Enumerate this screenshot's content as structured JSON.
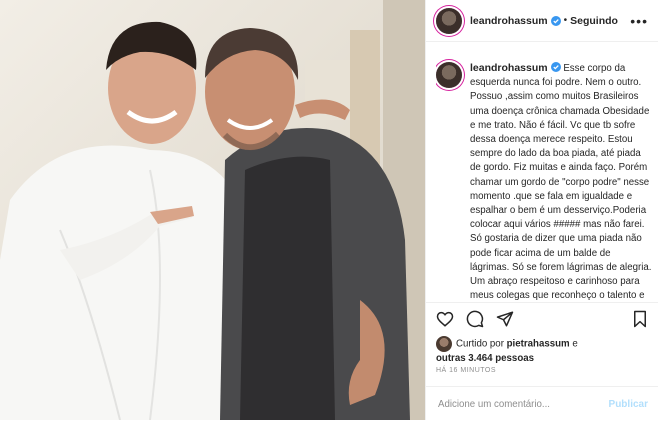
{
  "post": {
    "username": "leandrohassum",
    "follow_status": "Seguindo",
    "separator": "•",
    "more_label": "•••"
  },
  "caption": {
    "username": "leandrohassum",
    "text": "Esse corpo da esquerda nunca foi podre. Nem o outro. Possuo ,assim como muitos Brasileiros uma doença crônica chamada Obesidade e me trato. Não é fácil. Vc que tb sofre dessa doença merece respeito. Estou sempre do lado da boa piada, até piada de gordo. Fiz muitas e ainda faço. Porém chamar um gordo de \"corpo podre\" nesse momento .que se fala em igualdade e espalhar o bem é um desserviço.Poderia colocar aqui vários ##### mas não farei. Só gostaria de dizer que uma piada não pode ficar acima de um balde de lágrimas. Só se forem lágrimas de alegria. Um abraço respeitoso e carinhoso para meus colegas que reconheço o talento e"
  },
  "likes": {
    "prefix": "Curtido por",
    "user": "pietrahassum",
    "conjunction": "e",
    "others": "outras 3.464 pessoas"
  },
  "timestamp": "HÁ 16 MINUTOS",
  "comment": {
    "placeholder": "Adicione um comentário...",
    "publish_label": "Publicar"
  },
  "icons": [
    "heart-icon",
    "comment-icon",
    "share-icon",
    "save-icon",
    "verified-badge-icon",
    "more-options-icon"
  ],
  "colors": {
    "verified": "#3897f0",
    "publish": "#b2dffc",
    "story_ring": "#d6249f"
  }
}
